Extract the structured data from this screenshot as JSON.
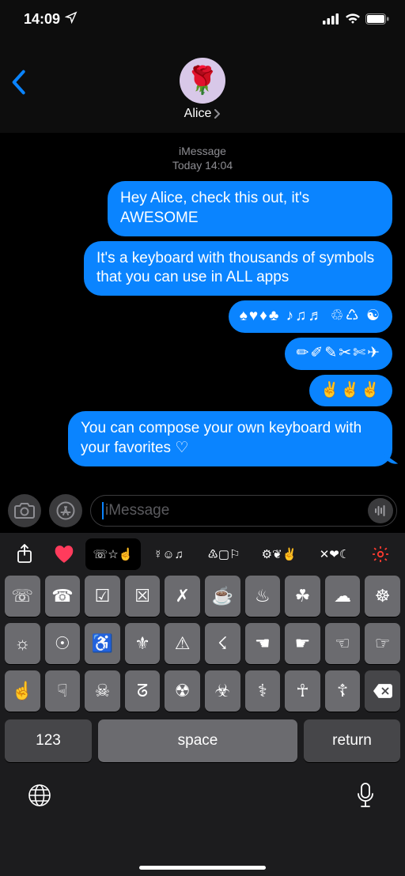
{
  "status": {
    "time": "14:09",
    "location_icon": true
  },
  "nav": {
    "contact_name": "Alice"
  },
  "conversation": {
    "service": "iMessage",
    "timestamp": "Today 14:04",
    "messages": [
      "Hey Alice, check this out, it's AWESOME",
      "It's a keyboard with thousands of symbols that you can use in ALL apps",
      "♠♥♦♣ ♪♫♬ ♲♺ ☯",
      "✏✐✎✂✄✈",
      "✌✌✌",
      "You can compose your own keyboard with your favorites ♡"
    ]
  },
  "compose": {
    "placeholder": "iMessage"
  },
  "keyboard": {
    "tabs": [
      "share",
      "heart",
      "☏☆☝",
      "☿☺♫",
      "♳▢⚐",
      "⚙❦✌",
      "✕❤☾",
      "gear"
    ],
    "rows": [
      [
        "☏",
        "☎",
        "☑",
        "☒",
        "✗",
        "☕",
        "♨",
        "☘",
        "☁",
        "☸"
      ],
      [
        "☼",
        "☉",
        "♿",
        "⚜",
        "⚠",
        "☇",
        "☚",
        "☛",
        "☜",
        "☞"
      ],
      [
        "☝",
        "☟",
        "☠",
        "ᘔ",
        "☢",
        "☣",
        "⚕",
        "☥",
        "☦",
        "⌫"
      ]
    ],
    "bottom": {
      "numbers": "123",
      "space": "space",
      "return": "return"
    }
  }
}
